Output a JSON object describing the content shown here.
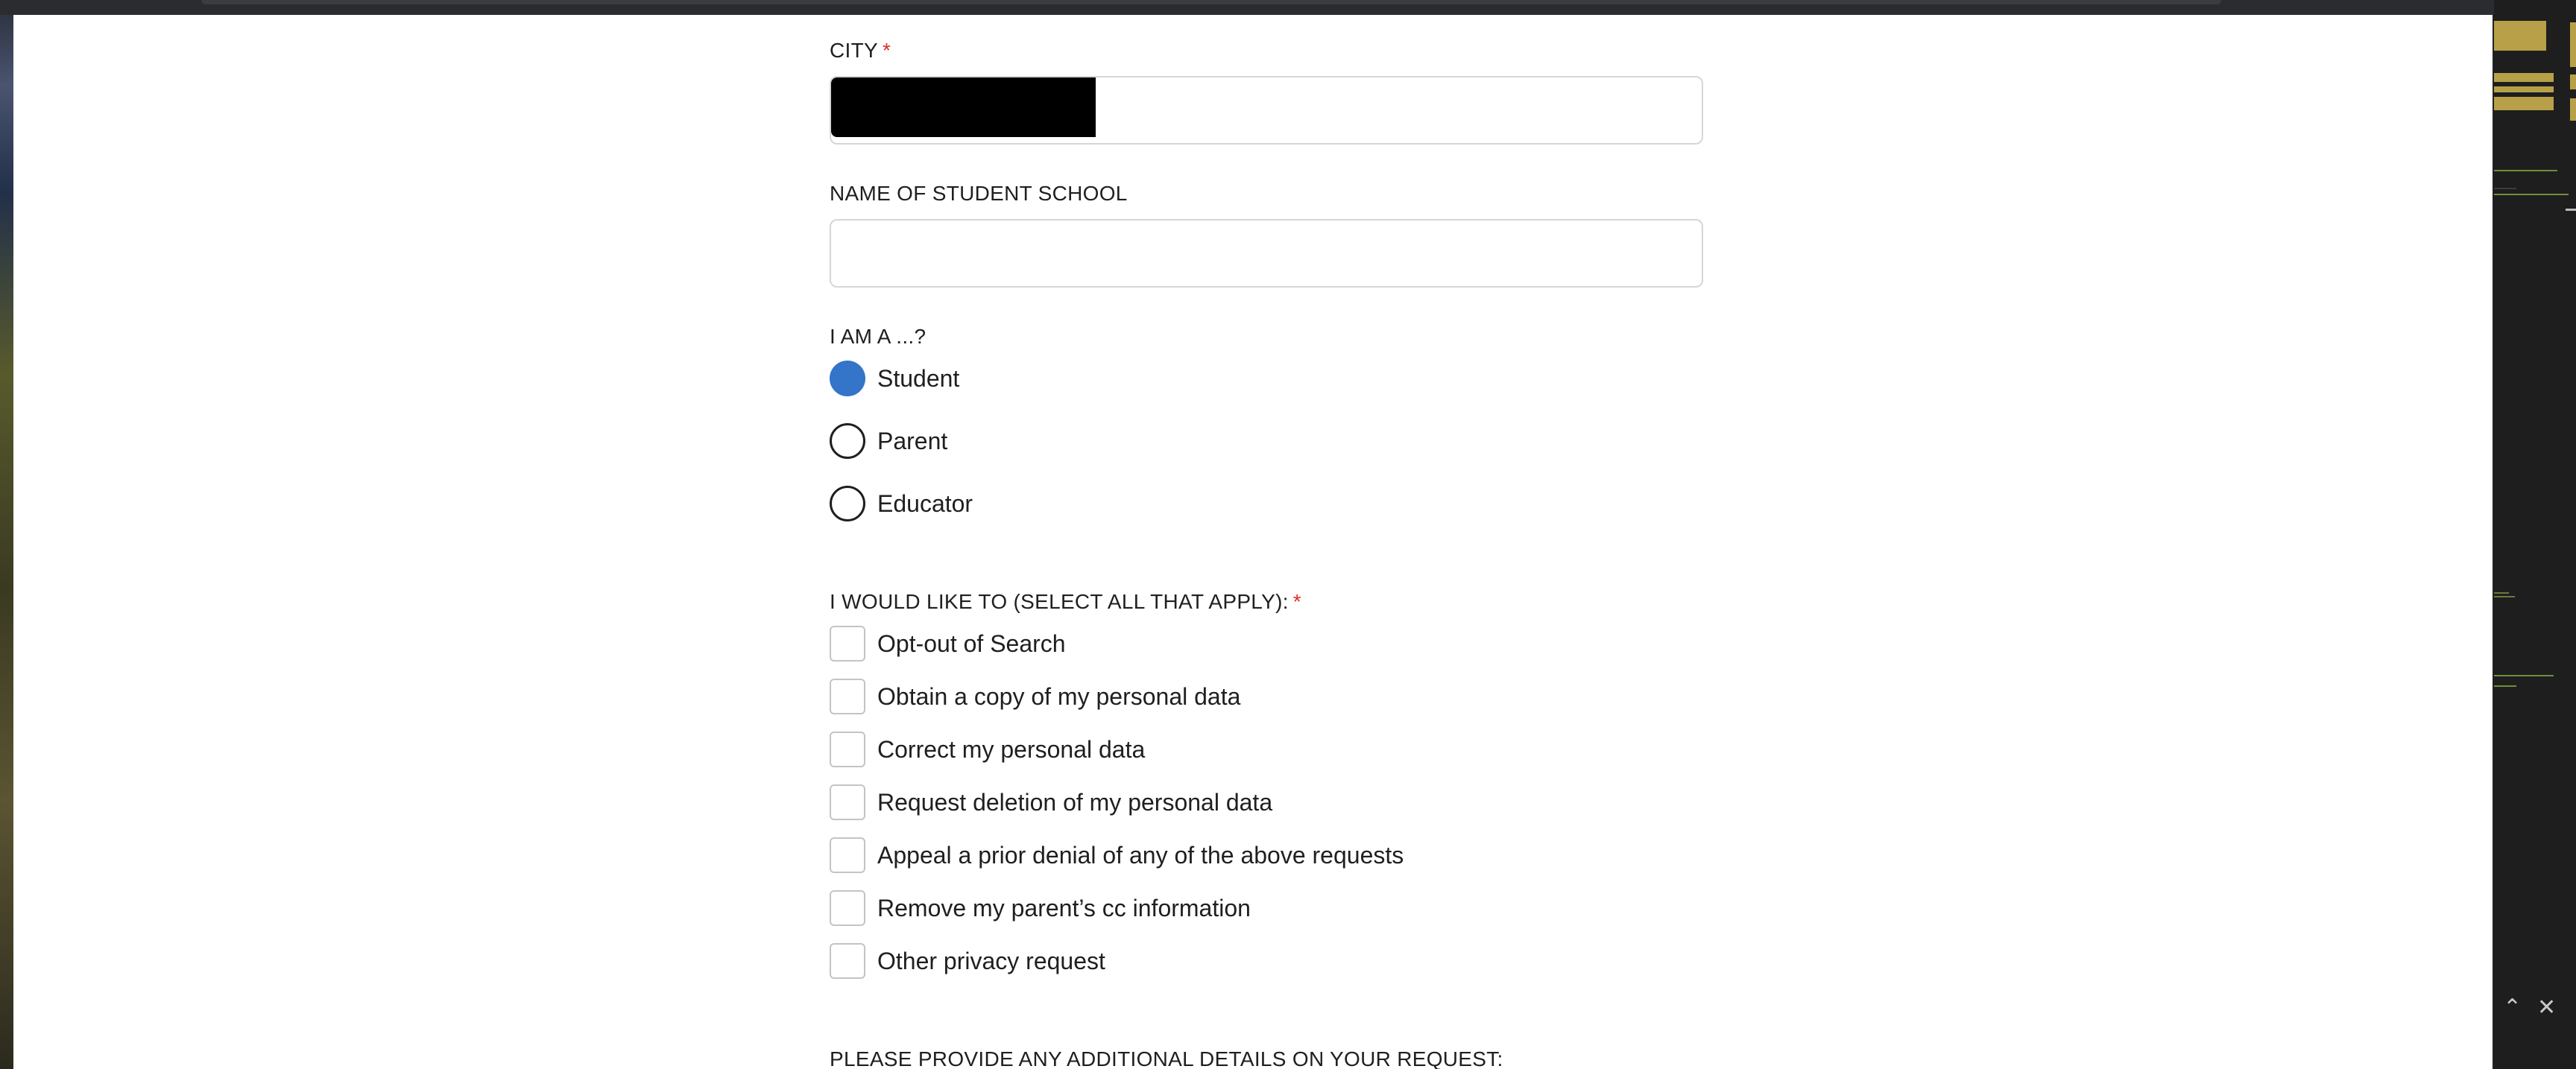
{
  "form": {
    "city": {
      "label": "CITY",
      "required_mark": "*",
      "value": ""
    },
    "school": {
      "label": "NAME OF STUDENT SCHOOL",
      "value": "",
      "placeholder": ""
    },
    "role": {
      "label": "I AM A ...?",
      "options": [
        {
          "label": "Student",
          "selected": true
        },
        {
          "label": "Parent",
          "selected": false
        },
        {
          "label": "Educator",
          "selected": false
        }
      ]
    },
    "requests": {
      "label": "I WOULD LIKE TO (SELECT ALL THAT APPLY):",
      "required_mark": "*",
      "options": [
        {
          "label": "Opt-out of Search",
          "checked": false
        },
        {
          "label": "Obtain a copy of my personal data",
          "checked": false
        },
        {
          "label": "Correct my personal data",
          "checked": false
        },
        {
          "label": "Request deletion of my personal data",
          "checked": false
        },
        {
          "label": "Appeal a prior denial of any of the above requests",
          "checked": false
        },
        {
          "label": "Remove my parent’s cc information",
          "checked": false
        },
        {
          "label": "Other privacy request",
          "checked": false
        }
      ]
    },
    "details": {
      "label": "PLEASE PROVIDE ANY ADDITIONAL DETAILS ON YOUR REQUEST:"
    }
  },
  "side_panel": {
    "icons": [
      "chevron-up-icon",
      "close-icon"
    ],
    "chevron_glyph": "⌃",
    "close_glyph": "✕"
  },
  "colors": {
    "accent": "#3474c9",
    "required": "#d93025",
    "page_bg": "#ffffff",
    "frame_bg": "#202124"
  }
}
